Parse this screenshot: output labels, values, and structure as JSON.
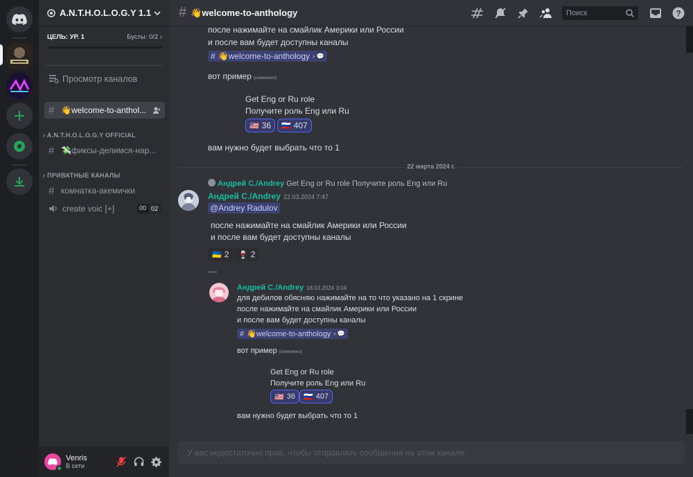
{
  "server": {
    "name": "A.N.T.H.O.L.O.G.Y 1.1",
    "boost_goal": "ЦЕЛЬ: УР. 1",
    "boosts": "Бусты: 0/2"
  },
  "sidebar": {
    "browse": "Просмотр каналов",
    "active_channel": "👋welcome-to-anthol...",
    "categories": [
      {
        "name": "A.N.T.H.O.L.O.G.Y OFFICIAL",
        "channels": [
          "💸фиксы-делимся-нар..."
        ]
      },
      {
        "name": "ПРИВАТНЫЕ КАНАЛЫ",
        "channels": [
          "комнатка-акемички"
        ]
      }
    ],
    "voice_channel": {
      "name": "create voic [+]",
      "count_a": "00",
      "count_b": "02"
    }
  },
  "user": {
    "name": "Venris",
    "status": "В сети"
  },
  "topbar": {
    "channel": "👋welcome-to-anthology",
    "search_placeholder": "Поиск"
  },
  "messages": {
    "top_line1": "после нажимайте на смайлик Америки или России",
    "top_line2": "и после вам будет доступны каналы",
    "channel_mention": "👋welcome-to-anthology",
    "example": "вот пример",
    "edited": "(изменено)",
    "role_title": "Get Eng or Ru role",
    "role_sub": "Получите роль Eng или Ru",
    "react_us": "36",
    "react_ru": "407",
    "choose": "вам нужно будет выбрать что то 1",
    "date_divider": "22 марта 2024 г.",
    "reply_author": "Андрей С./Andrey",
    "reply_text": "Get Eng or Ru role Получите роль Eng или Ru",
    "author": "Андрей С./Andrey",
    "timestamp": "22.03.2024 7:47",
    "mention_user": "@Andrey Radulov",
    "body_line1": "после нажимайте на смайлик Америки или России",
    "body_line2": "и после вам будет доступны каналы",
    "react_ua": "2",
    "react_bottle": "2",
    "dots": "....",
    "embed": {
      "author": "Андрей С./Andrey",
      "timestamp": "18.03.2024 3:04",
      "line1": "для дебилов обясняю нажимайте на то что указано на 1 скрине",
      "line2": "после нажимайте на смайлик Америки или России",
      "line3": "и после вам будет доступны каналы",
      "channel_mention": "👋welcome-to-anthology",
      "example": "вот пример",
      "edited": "(изменено)",
      "role_title": "Get Eng or Ru role",
      "role_sub": "Получите роль Eng или Ru",
      "react_us": "36",
      "react_ru": "407",
      "choose": "вам нужно будет выбрать что то 1"
    }
  },
  "composer": {
    "placeholder": "У вас недостаточно прав, чтобы отправлять сообщения на этом канале."
  },
  "colors": {
    "accent": "#5865f2",
    "author": "#1abc9c",
    "online": "#23a559",
    "bg": "#313338"
  }
}
